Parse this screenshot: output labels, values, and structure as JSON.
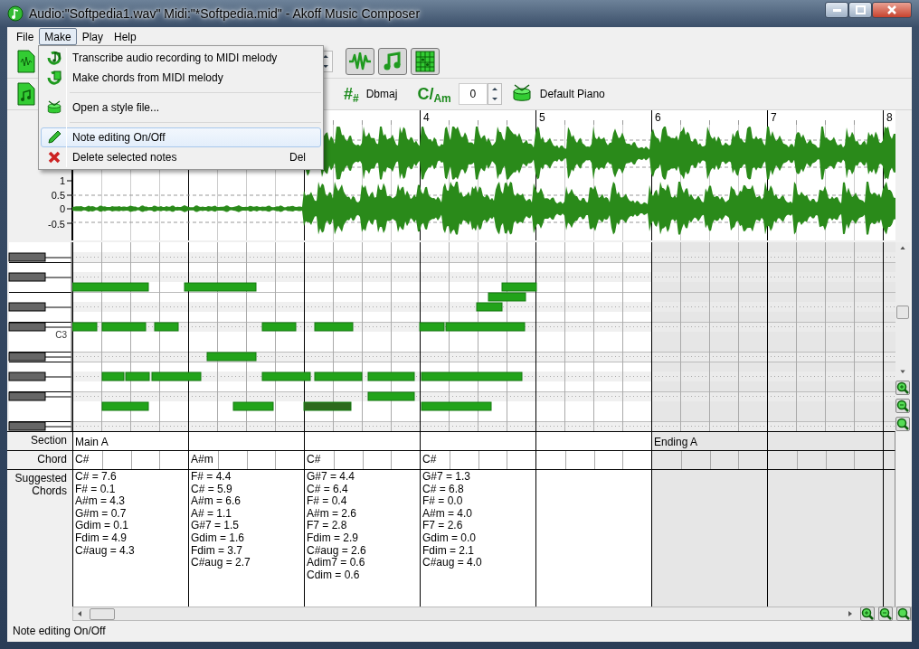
{
  "window": {
    "title": "Audio:\"Softpedia1.wav\" Midi:\"*Softpedia.mid\" - Akoff Music Composer"
  },
  "menu_bar": [
    {
      "label": "File",
      "selected": false
    },
    {
      "label": "Make",
      "selected": true
    },
    {
      "label": "Play",
      "selected": false
    },
    {
      "label": "Help",
      "selected": false
    }
  ],
  "make_menu": [
    {
      "kind": "item",
      "label": "Transcribe audio recording to MIDI melody",
      "selected": false
    },
    {
      "kind": "item",
      "label": "Make chords from MIDI melody",
      "selected": false
    },
    {
      "kind": "separator"
    },
    {
      "kind": "item",
      "label": "Open a style file...",
      "selected": false
    },
    {
      "kind": "separator"
    },
    {
      "kind": "item",
      "label": "Note editing On/Off",
      "selected": true
    },
    {
      "kind": "item",
      "label": "Delete selected notes",
      "shortcut": "Del",
      "selected": false
    }
  ],
  "toolbar": {
    "key_symbol": "#$_{#}$",
    "key": "Dbmaj",
    "relative_key_symbol": "C/$_{Am}$",
    "transpose": "0",
    "instrument": "Default Piano"
  },
  "ruler": {
    "measures": [
      "4",
      "5",
      "6",
      "7",
      "8"
    ]
  },
  "waveform": {
    "axis_labels": [
      "1",
      "0.5",
      "0",
      "-0.5"
    ]
  },
  "piano_roll": {
    "key_label": "C3"
  },
  "chord_table": {
    "row_labels": [
      "Section",
      "Chord",
      "Suggested Chords"
    ],
    "measures": [
      {
        "section": "Main A",
        "chord": "C#",
        "suggested": [
          "C# = 7.6",
          "F# = 0.1",
          "A#m = 4.3",
          "G#m = 0.7",
          "Gdim = 0.1",
          "Fdim = 4.9",
          "C#aug = 4.3"
        ],
        "shaded": false
      },
      {
        "chord": "A#m",
        "suggested": [
          "F# = 4.4",
          "C# = 5.9",
          "A#m = 6.6",
          "A# = 1.1",
          "G#7 = 1.5",
          "Gdim = 1.6",
          "Fdim = 3.7",
          "C#aug = 2.7"
        ],
        "shaded": false
      },
      {
        "chord": "C#",
        "suggested": [
          "G#7 = 4.4",
          "C# = 6.4",
          "F# = 0.4",
          "A#m = 2.6",
          "F7 = 2.8",
          "Fdim = 2.9",
          "C#aug = 2.6",
          "Adim7 = 0.6",
          "Cdim = 0.6"
        ],
        "shaded": false
      },
      {
        "chord": "C#",
        "suggested": [
          "G#7 = 1.3",
          "C# = 6.8",
          "F# = 0.0",
          "A#m = 4.0",
          "F7 = 2.6",
          "Gdim = 0.0",
          "Fdim = 2.1",
          "C#aug = 4.0"
        ],
        "shaded": false
      },
      {
        "shaded": false
      },
      {
        "section": "Ending A",
        "shaded": true
      },
      {
        "shaded": true
      }
    ]
  },
  "status_bar": {
    "text": "Note editing On/Off"
  }
}
